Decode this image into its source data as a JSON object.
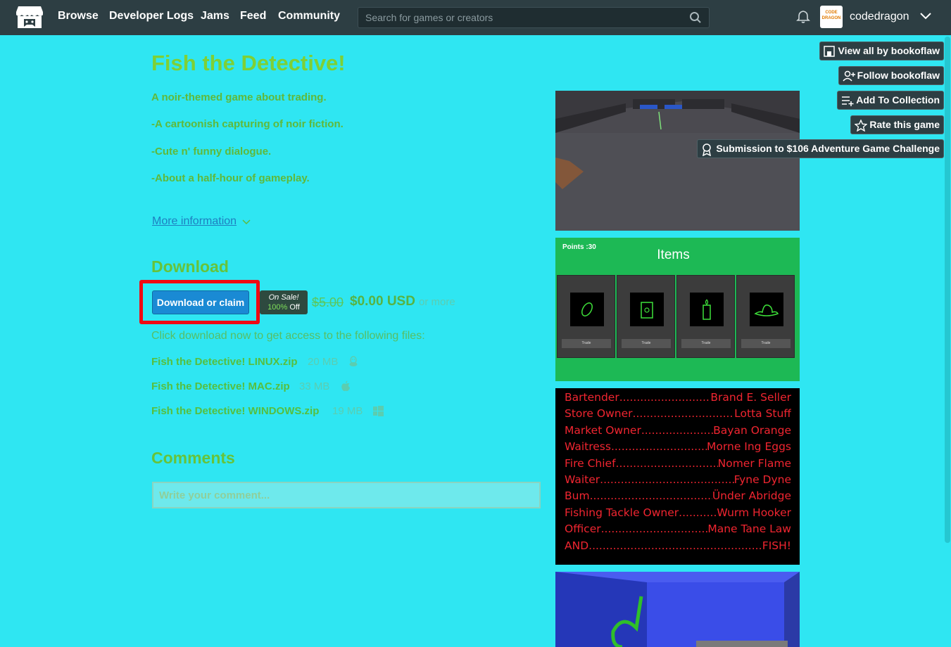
{
  "header": {
    "nav": [
      "Browse",
      "Developer Logs",
      "Jams",
      "Feed",
      "Community"
    ],
    "search_placeholder": "Search for games or creators",
    "username": "codedragon",
    "avatar_text": "CODE DRAGON"
  },
  "game": {
    "title": "Fish the Detective!",
    "description": [
      "A noir-themed game about trading.",
      "-A cartoonish capturing of noir fiction.",
      "-Cute n' funny dialogue.",
      "-About a half-hour of gameplay."
    ],
    "more_info": "More information"
  },
  "download": {
    "heading": "Download",
    "button": "Download or claim",
    "sale_label": "On Sale!",
    "sale_pct": "100%",
    "sale_off": "Off",
    "old_price": "$5.00",
    "new_price": "$0.00 USD",
    "or_more": "or more",
    "instructions": "Click download now to get access to the following files:",
    "files": [
      {
        "name": "Fish the Detective! LINUX.zip",
        "size": "20 MB",
        "icon": "linux-icon"
      },
      {
        "name": "Fish the Detective! MAC.zip",
        "size": "33 MB",
        "icon": "apple-icon"
      },
      {
        "name": "Fish the Detective! WINDOWS.zip",
        "size": "19 MB",
        "icon": "windows-icon"
      }
    ]
  },
  "comments": {
    "heading": "Comments",
    "placeholder": "Write your comment..."
  },
  "sidebar": {
    "view_all": "View all by bookoflaw",
    "follow": "Follow bookoflaw",
    "add_collection": "Add To Collection",
    "rate": "Rate this game",
    "submission": "Submission to $106 Adventure Game Challenge"
  },
  "screenshot2": {
    "points": "Points :30",
    "title": "Items",
    "trade_label": "Trade"
  },
  "credits": [
    [
      "Bartender",
      "Brand E. Seller"
    ],
    [
      "Store Owner",
      "Lotta Stuff"
    ],
    [
      "Market Owner",
      "Bayan Orange"
    ],
    [
      "Waitress",
      "Morne Ing Eggs"
    ],
    [
      "Fire Chief",
      "Nomer Flame"
    ],
    [
      "Waiter",
      "Fyne Dyne"
    ],
    [
      "Bum",
      "Ünder Abridge"
    ],
    [
      "Fishing Tackle Owner",
      "Wurm Hooker"
    ],
    [
      "Officer",
      "Mane Tane Law"
    ],
    [
      "AND",
      "FISH!"
    ]
  ],
  "colors": {
    "page_bg": "#2fe6f2",
    "topbar": "#2d3e43",
    "title": "#7ed035",
    "link": "#1e7fc0",
    "button": "#1a8ad4",
    "highlight": "#f00a12"
  }
}
